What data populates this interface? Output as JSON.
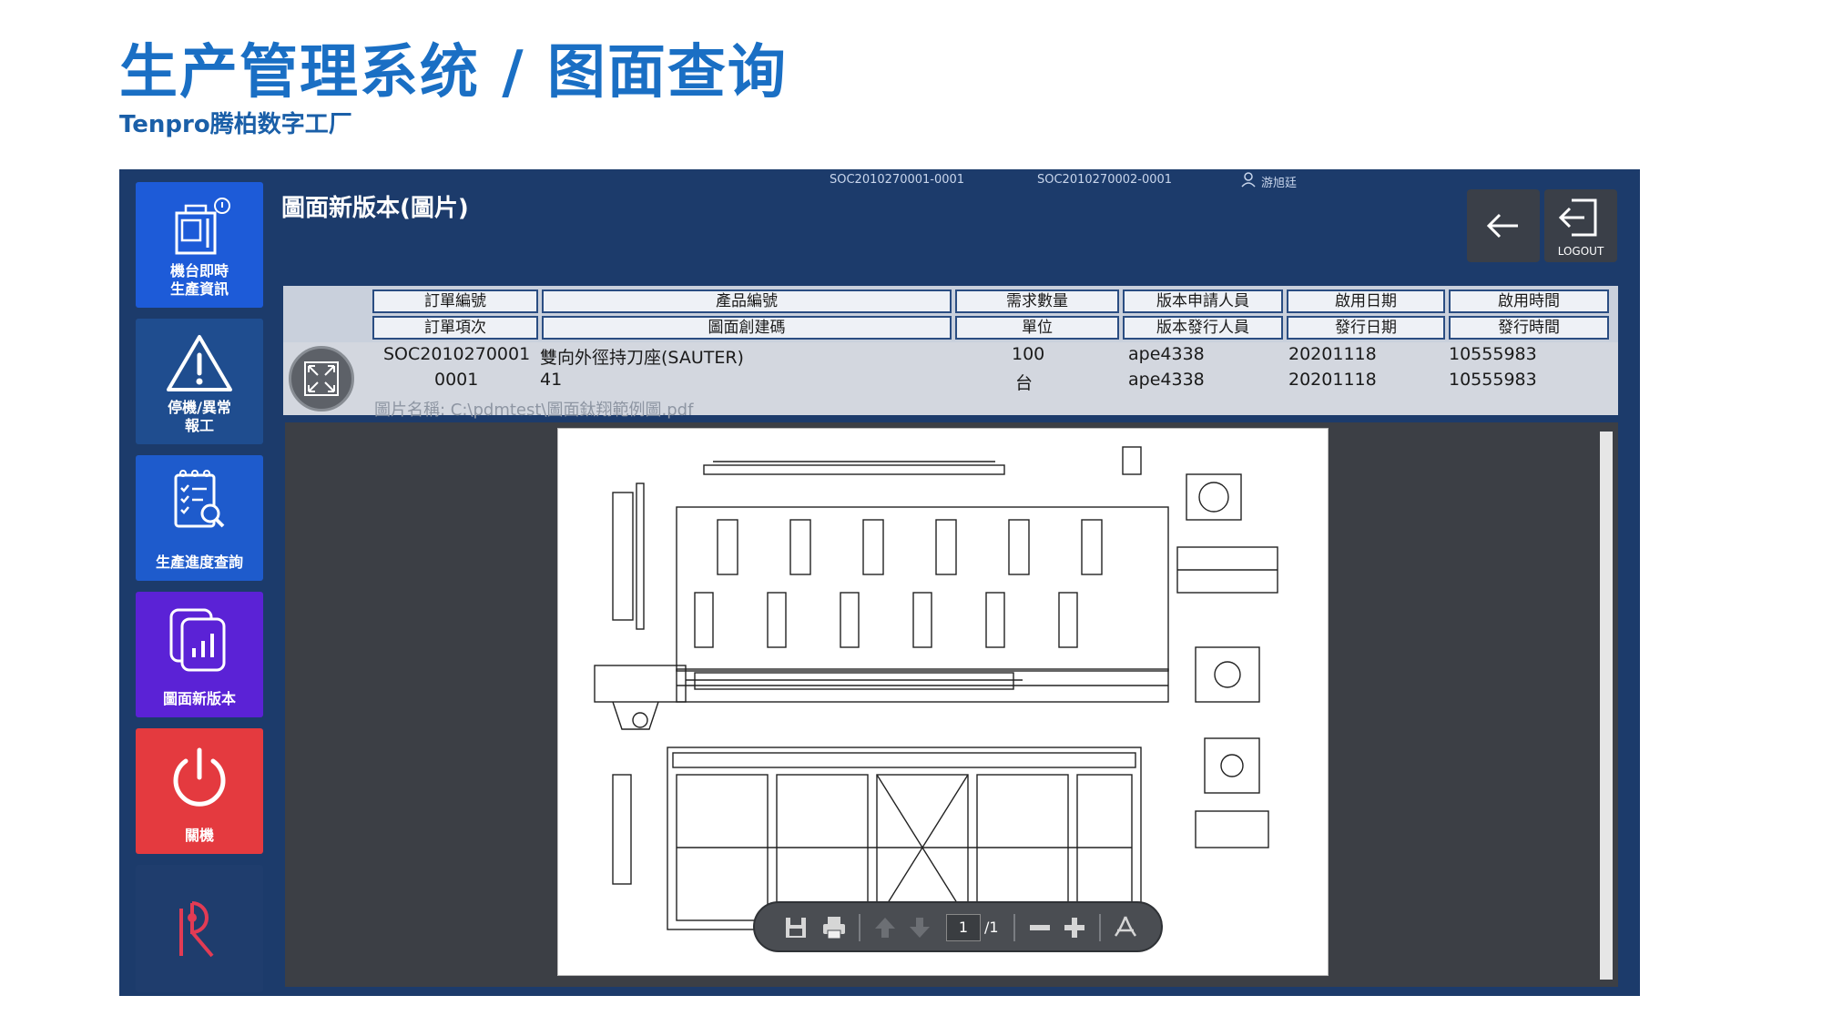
{
  "slide": {
    "title": "生产管理系统 / 图面查询",
    "subtitle": "Tenpro腾柏数字工厂"
  },
  "topbar": {
    "order1": "SOC2010270001-0001",
    "order2": "SOC2010270002-0001",
    "user": "游旭廷"
  },
  "sidebar": {
    "items": [
      {
        "label": "機台即時\n生產資訊",
        "icon": "machine-icon",
        "color": "#1d5bd8"
      },
      {
        "label": "停機/異常\n報工",
        "icon": "warning-icon",
        "color": "#1f4d8f"
      },
      {
        "label": "生產進度查詢",
        "icon": "clipboard-search-icon",
        "color": "#1e5bcc"
      },
      {
        "label": "圖面新版本",
        "icon": "chart-docs-icon",
        "color": "#5b22d6"
      },
      {
        "label": "關機",
        "icon": "power-icon",
        "color": "#e43a3f"
      },
      {
        "label": "TENPRO",
        "icon": "tenpro-logo"
      }
    ]
  },
  "screen": {
    "title": "圖面新版本(圖片)",
    "logout_label": "LOGOUT"
  },
  "table": {
    "header_row1": [
      "訂單編號",
      "產品編號",
      "需求數量",
      "版本申請人員",
      "啟用日期",
      "啟用時間"
    ],
    "header_row2": [
      "訂單項次",
      "圖面創建碼",
      "單位",
      "版本發行人員",
      "發行日期",
      "發行時間"
    ],
    "row1": [
      "SOC2010270001",
      "雙向外徑持刀座(SAUTER)",
      "100",
      "ape4338",
      "20201118",
      "10555983"
    ],
    "row2": [
      "0001",
      "41",
      "台",
      "ape4338",
      "20201118",
      "10555983"
    ],
    "filename": "圖片名稱: C:\\pdmtest\\圖面鈦翔範例圖.pdf"
  },
  "pdf_toolbar": {
    "page_current": "1",
    "page_total": "/1"
  }
}
